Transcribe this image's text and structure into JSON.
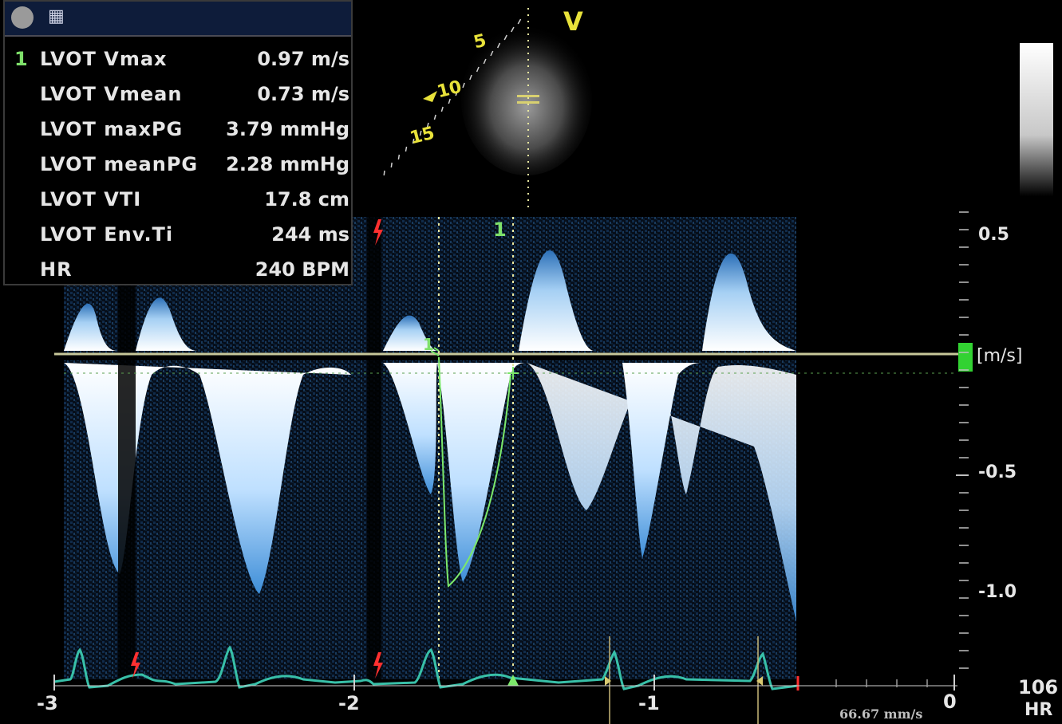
{
  "measurements": {
    "title_icon": "calculator-icon",
    "selected_index": "1",
    "rows": [
      {
        "label": "LVOT Vmax",
        "value": "0.97 m/s"
      },
      {
        "label": "LVOT Vmean",
        "value": "0.73 m/s"
      },
      {
        "label": "LVOT maxPG",
        "value": "3.79 mmHg"
      },
      {
        "label": "LVOT meanPG",
        "value": "2.28 mmHg"
      },
      {
        "label": "LVOT VTI",
        "value": "17.8 cm"
      },
      {
        "label": "LVOT Env.Ti",
        "value": "244 ms"
      },
      {
        "label": "HR",
        "value": "240 BPM"
      }
    ]
  },
  "bmode": {
    "depth_labels": [
      "5",
      "10",
      "15"
    ],
    "orientation_marker": "V"
  },
  "doppler": {
    "cursor_marker": "1",
    "scale_labels": [
      "0.5",
      "[m/s]",
      "-0.5",
      "-1.0"
    ],
    "time_labels": [
      "-3",
      "-2",
      "-1",
      "0"
    ],
    "sweep_speed": "66.67 mm/s",
    "hr_value": "106",
    "hr_label": "HR",
    "colors": {
      "spectrum": "#5aa8e8",
      "baseline": "#c8c89a",
      "ecg": "#38c0a8",
      "trace": "#7ce86a",
      "marker": "#e8e23a",
      "r_wave": "#ff3030"
    }
  }
}
